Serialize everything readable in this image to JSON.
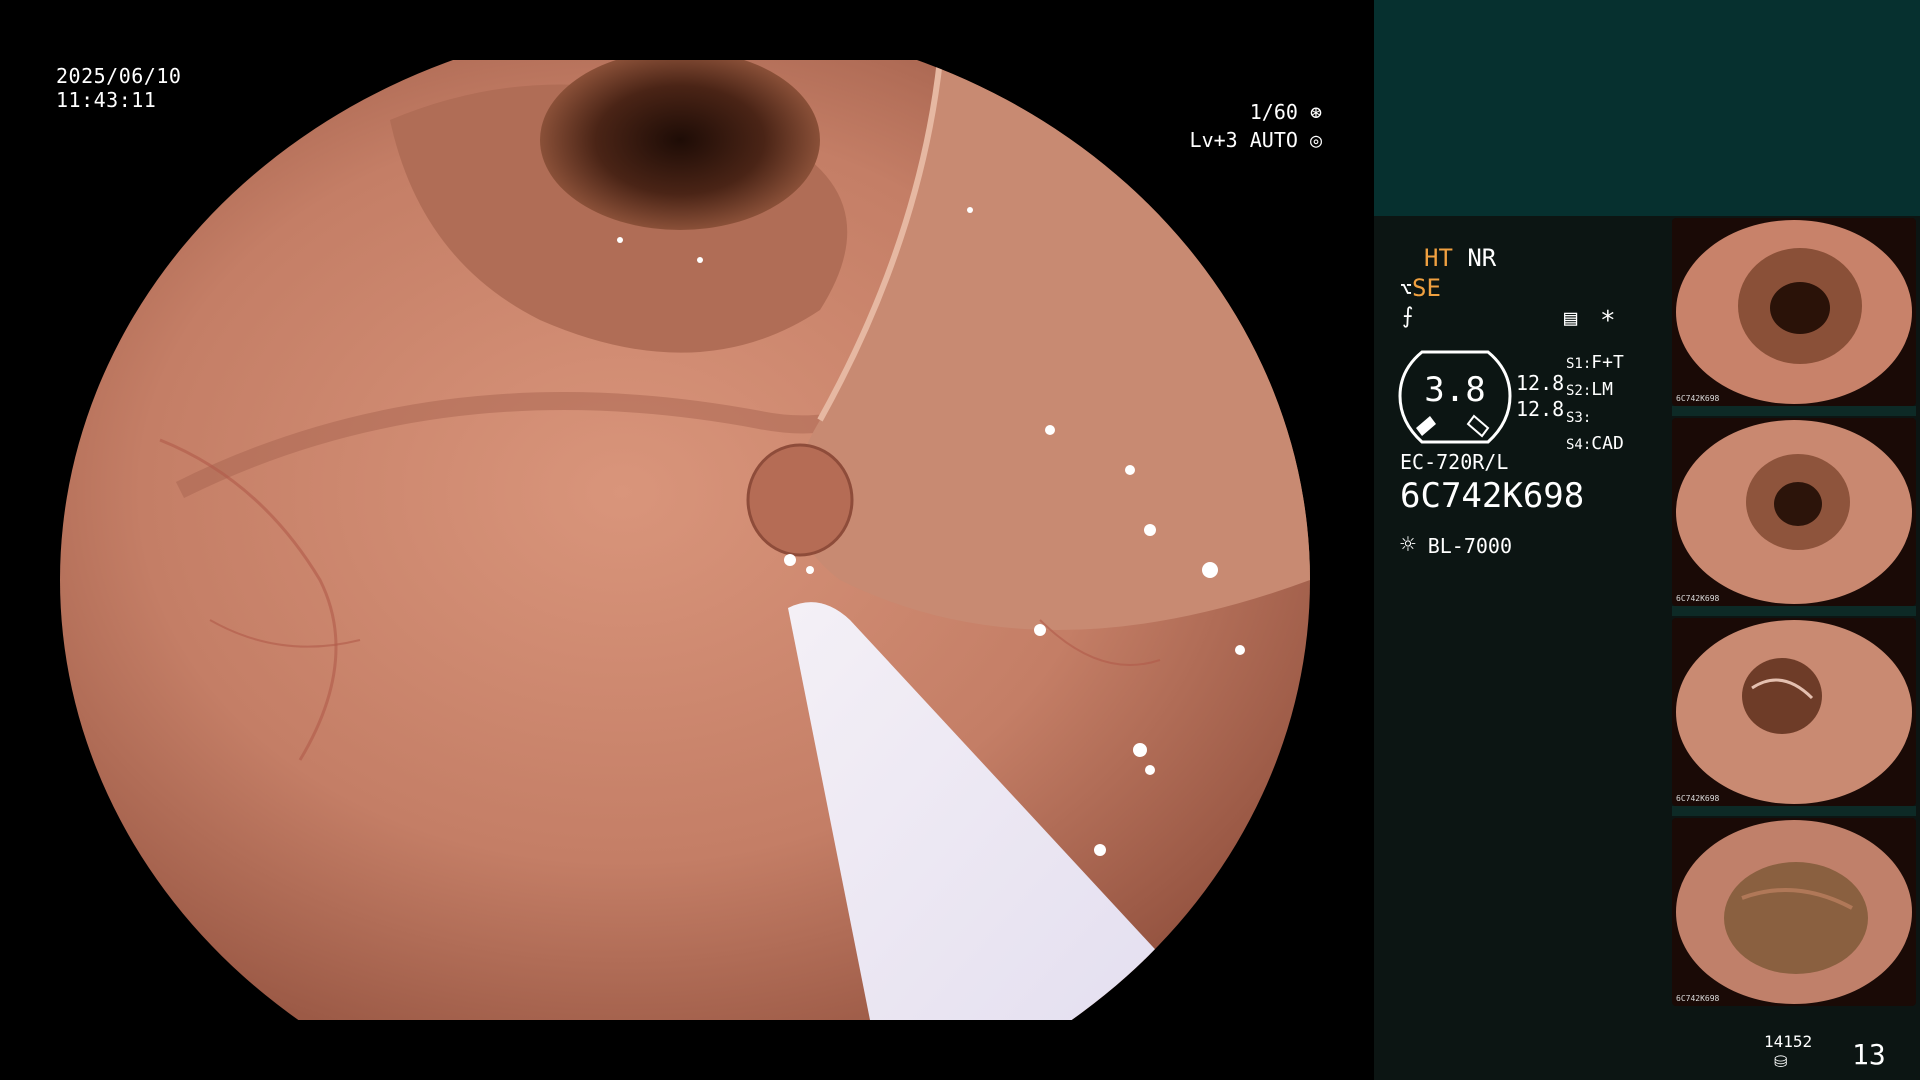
{
  "overlay": {
    "date": "2025/06/10",
    "time": "11:43:11",
    "shutter": "1/60",
    "level": "Lv+3 AUTO"
  },
  "panel": {
    "ht": "HT",
    "nr": "NR",
    "se": "SE",
    "zoom": "3.8",
    "val1": "12.8",
    "val2": "12.8",
    "s1_key": "S1:",
    "s1_val": "F+T",
    "s2_key": "S2:",
    "s2_val": "LM",
    "s3_key": "S3:",
    "s3_val": "",
    "s4_key": "S4:",
    "s4_val": "CAD",
    "asterisk": "*",
    "scope_model": "EC-720R/L",
    "serial": "6C742K698",
    "light_source": "BL-7000",
    "counter_small": "14152",
    "counter_big": "13"
  },
  "thumbnails": [
    {
      "label": "6C742K698"
    },
    {
      "label": "6C742K698"
    },
    {
      "label": "6C742K698"
    },
    {
      "label": "6C742K698"
    }
  ],
  "colors": {
    "panel_top": "#06302f",
    "panel_bg": "#0c1513",
    "accent_orange": "#f0a040",
    "mucosa": "#c9826a"
  }
}
